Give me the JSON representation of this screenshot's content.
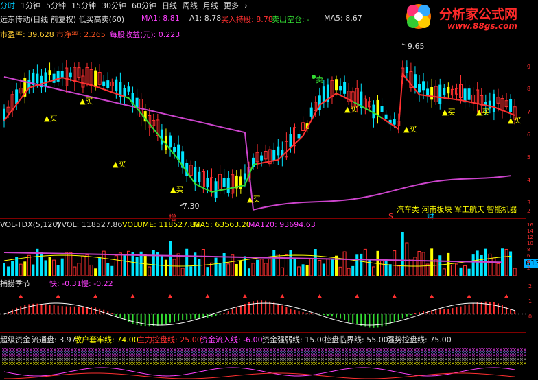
{
  "menu": {
    "items": [
      "分时",
      "1分钟",
      "5分钟",
      "15分钟",
      "30分钟",
      "60分钟",
      "日线",
      "周线",
      "月线",
      "更多",
      "›"
    ],
    "active_index": 0
  },
  "main_panel": {
    "stock_title": "远东传动(日线 前复权) 低买高卖(60)",
    "ma1": "MA1: 8.81",
    "a1": "A1: 8.78",
    "buy_hold": "买入持股: 8.78",
    "sell_empty": "卖出空仓: -",
    "ma5": "MA5: 8.67",
    "pe": "市盈率: 39.628",
    "pb": "市净率: 2.265",
    "eps": "每股收益(元): 0.223",
    "high_label": "9.65",
    "low_label": "7.30",
    "buy_marks": [
      "买",
      "买",
      "买",
      "买",
      "买",
      "买",
      "买",
      "买",
      "买",
      "买"
    ],
    "sell_mark": "卖",
    "extra_marks": [
      "增",
      "财",
      "S"
    ],
    "concepts": "汽车类  河南板块  军工航天  智能机器"
  },
  "vol_panel": {
    "title": "VOL-TDX(5,120)",
    "vvol": "VVOL: 118527.86",
    "volume": "VOLUME: 118527.86",
    "ma5": "MA5: 63563.20",
    "ma120": "MA120: 93694.63",
    "right_label": "613"
  },
  "season_panel": {
    "title": "捕捞季节",
    "fast": "快: -0.31",
    "slow": "慢: -0.22"
  },
  "fund_panel": {
    "title": "超级资金",
    "liutong": "流通盘: 3.97",
    "retail": "散户套牢线: 74.00",
    "main_control": "主力控盘线: 25.00",
    "inflow": "资金流入线: -6.00",
    "strong": "资金强弱线: 15.00",
    "critical": "控盘临界线: 55.00",
    "strong_ctrl": "强势控盘线: 75.00"
  },
  "right_axis": {
    "main_ticks": [
      "9",
      "8",
      "7",
      "6",
      "5",
      "4",
      "3",
      "2"
    ],
    "vol_ticks": [
      "16",
      "14",
      "12",
      "10",
      "8",
      "6",
      "4",
      "2"
    ],
    "season_ticks": [
      "2",
      "1",
      "0"
    ]
  },
  "logo": {
    "text": "分析家公式网",
    "url": "www.88gs.com"
  },
  "colors": {
    "up": "#ff3030",
    "down": "#00e5ff",
    "yellow": "#ffff00",
    "magenta": "#cc44cc",
    "green": "#33dd33",
    "label_red": "#ff3030",
    "label_magenta": "#ff40ff"
  }
}
